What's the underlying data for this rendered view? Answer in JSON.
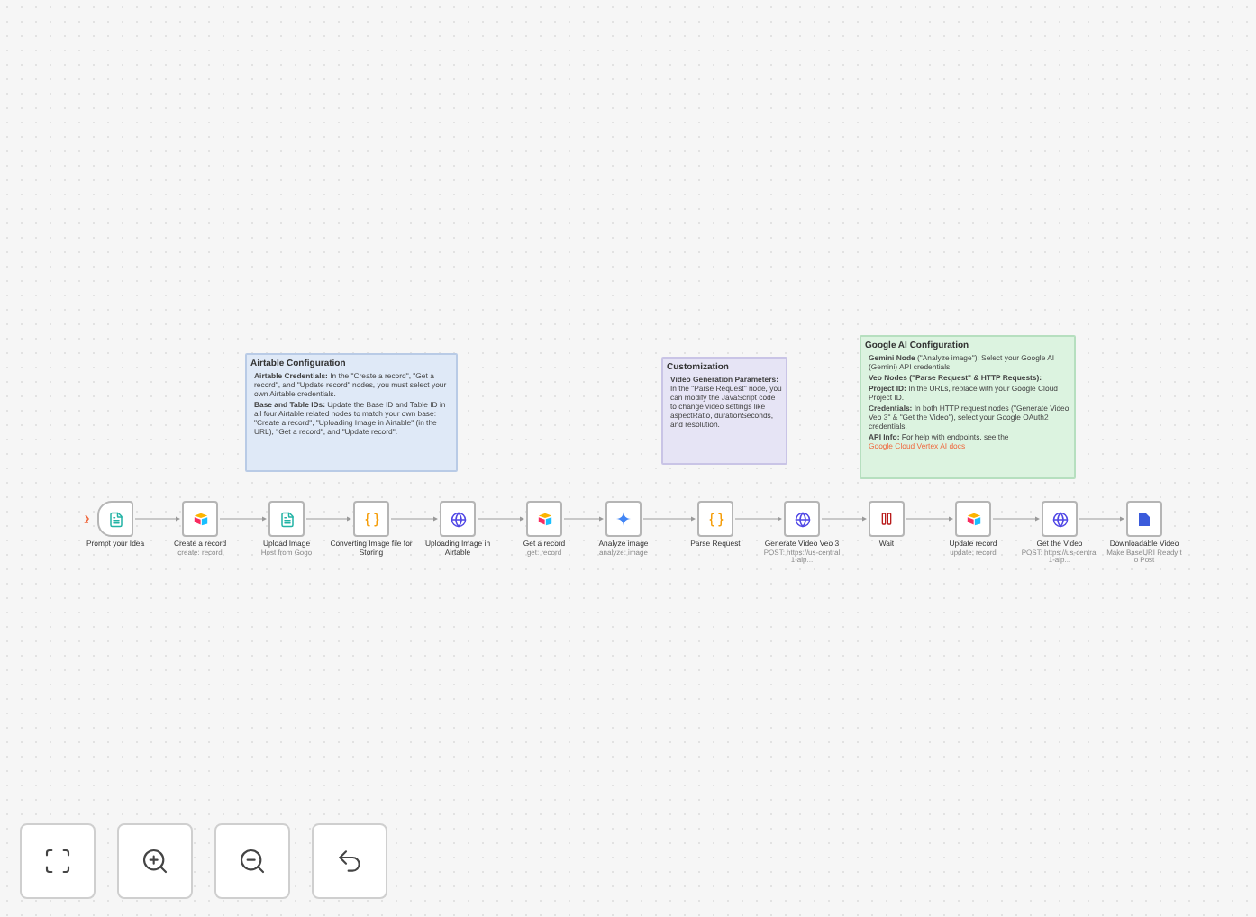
{
  "sticky_notes": [
    {
      "kind": "blue",
      "title": "Airtable Configuration",
      "items": [
        "**Airtable Credentials:** In the \"Create a record\", \"Get a record\", and \"Update record\" nodes, you must select your own Airtable credentials.",
        "**Base and Table IDs:** Update the Base ID and Table ID in all four Airtable related nodes to match your own base: \"Create a record\", \"Uploading Image in Airtable\" (in the URL), \"Get a record\", and \"Update record\"."
      ]
    },
    {
      "kind": "purple",
      "title": "Customization",
      "items": [
        "**Video Generation Parameters:** In the \"Parse Request\" node, you can modify the JavaScript code to change video settings like aspectRatio, durationSeconds, and resolution."
      ]
    },
    {
      "kind": "green",
      "title": "Google AI Configuration",
      "items": [
        "**Gemini Node** (\"Analyze image\"): Select your Google AI (Gemini) API credentials.",
        "**Veo Nodes (\"Parse Request\" & HTTP Requests):**",
        "**Project ID:** In the URLs, replace with your Google Cloud Project ID.",
        "**Credentials:** In both HTTP request nodes (\"Generate Video Veo 3\" & \"Get the Video\"), select your Google OAuth2 credentials.",
        "**API Info:** For help with endpoints, see the"
      ],
      "link": "Google Cloud Vertex AI docs"
    }
  ],
  "nodes": [
    {
      "kind": "form",
      "label": "Prompt your Idea"
    },
    {
      "kind": "airtable",
      "label": "Create a record",
      "subtitle": "create: record"
    },
    {
      "kind": "file",
      "label": "Upload Image",
      "subtitle": "Host from Gogo"
    },
    {
      "kind": "code",
      "label": "Converting Image file for Storing"
    },
    {
      "kind": "http",
      "label": "Uploading Image in Airtable"
    },
    {
      "kind": "airtable",
      "label": "Get a record",
      "subtitle": "get: record"
    },
    {
      "kind": "gemini",
      "label": "Analyze image",
      "subtitle": "analyze: image"
    },
    {
      "kind": "code",
      "label": "Parse Request"
    },
    {
      "kind": "http",
      "label": "Generate Video Veo 3",
      "subtitle": "POST: https://us-central1-aip..."
    },
    {
      "kind": "wait",
      "label": "Wait"
    },
    {
      "kind": "airtable",
      "label": "Update record",
      "subtitle": "update: record"
    },
    {
      "kind": "http",
      "label": "Get the Video",
      "subtitle": "POST: https://us-central1-aip..."
    },
    {
      "kind": "drive",
      "label": "Downloadable Video",
      "subtitle": "Make BaseURI Ready to Post"
    }
  ],
  "controls": [
    {
      "kind": "fit"
    },
    {
      "kind": "zoom_in"
    },
    {
      "kind": "zoom_out"
    },
    {
      "kind": "undo"
    }
  ]
}
